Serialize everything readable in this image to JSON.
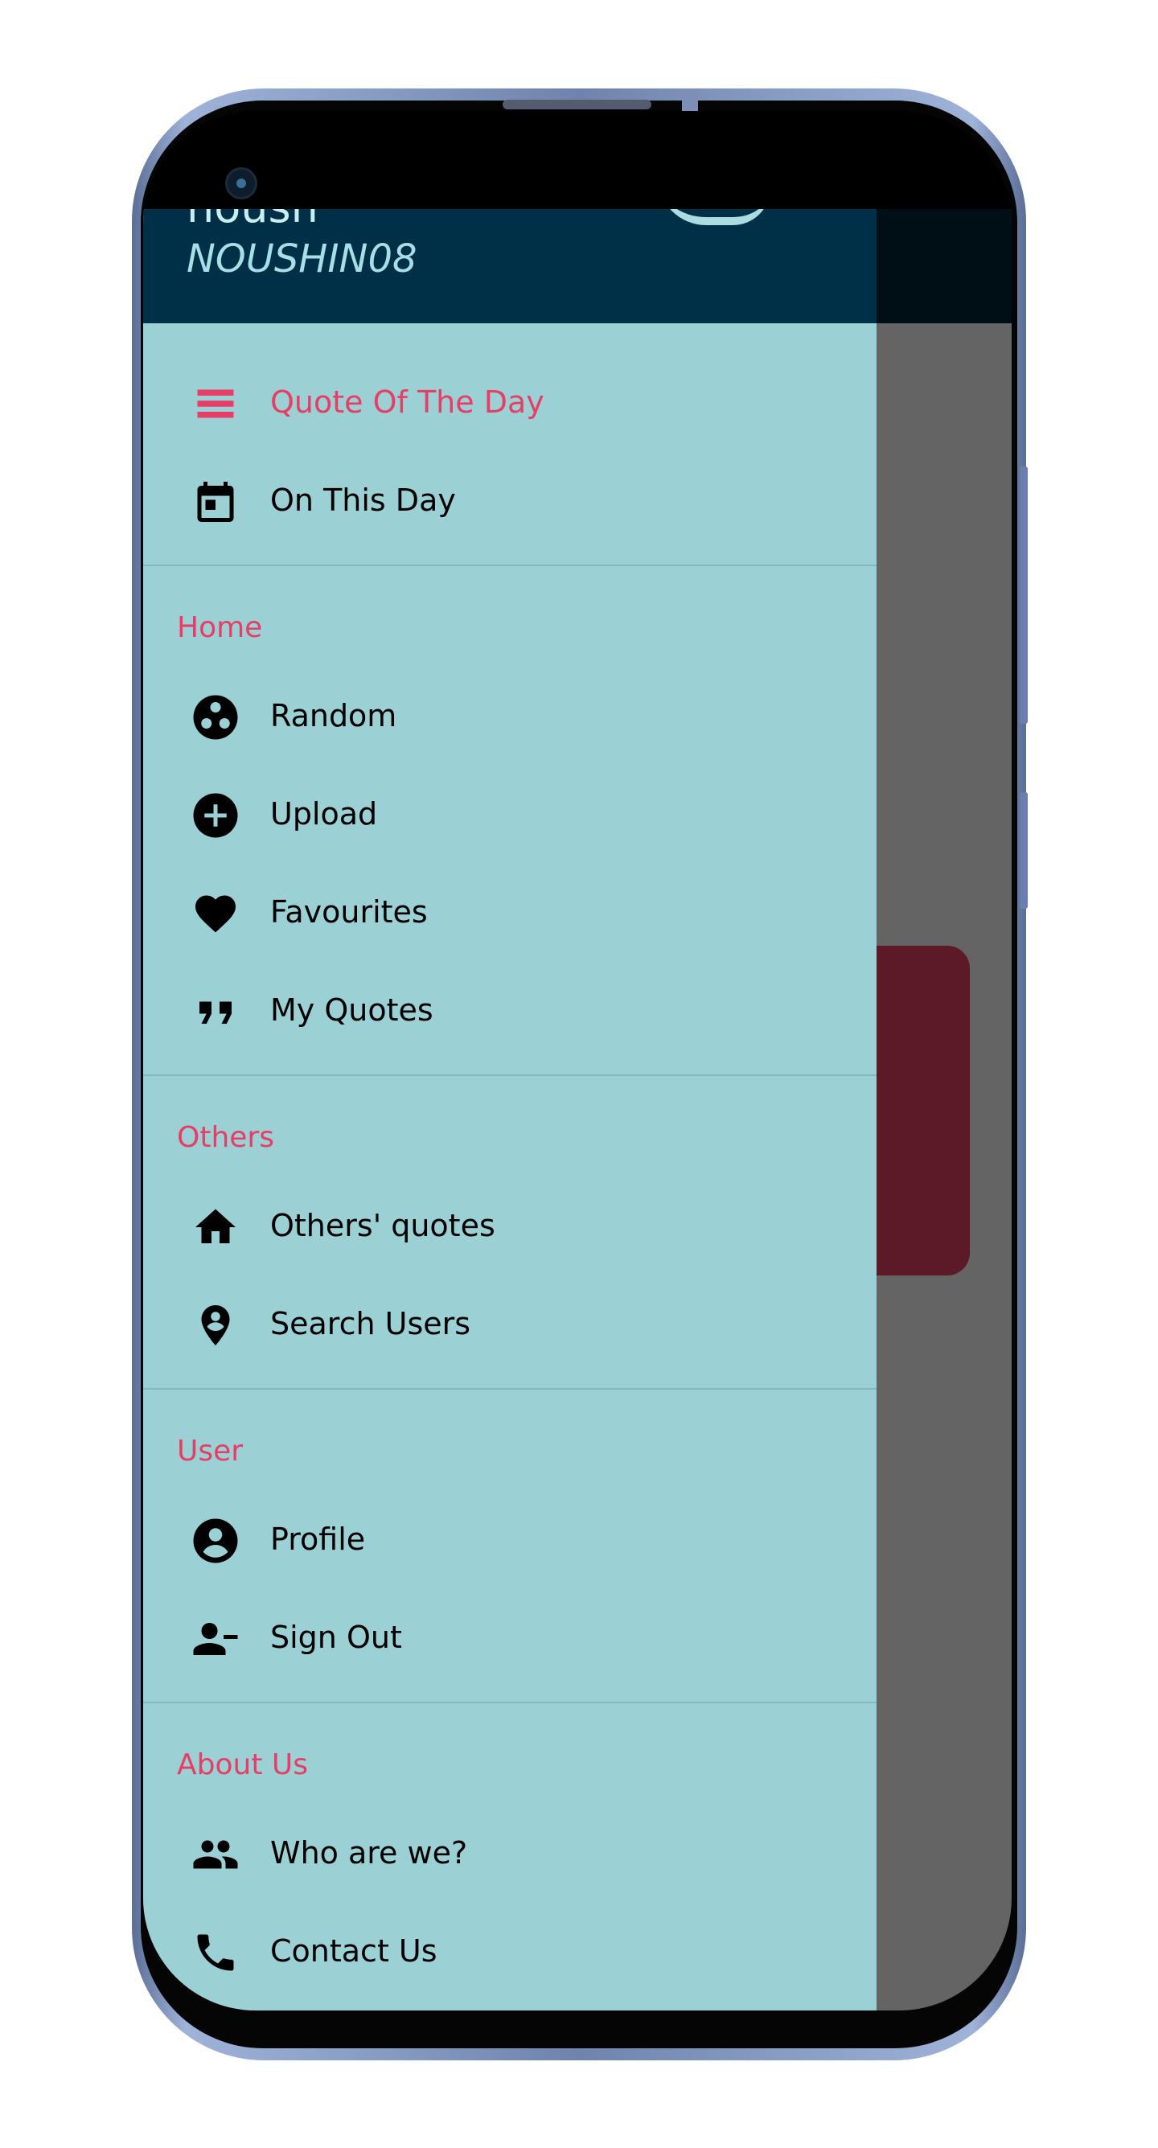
{
  "drawer": {
    "header": {
      "name": "noush",
      "username": "NOUSHIN08"
    },
    "top_items": [
      {
        "label": "Quote Of The Day",
        "icon": "list-icon",
        "active": true
      },
      {
        "label": "On This Day",
        "icon": "calendar-icon",
        "active": false
      }
    ],
    "sections": [
      {
        "title": "Home",
        "items": [
          {
            "label": "Random",
            "icon": "random-icon"
          },
          {
            "label": "Upload",
            "icon": "add-circle-icon"
          },
          {
            "label": "Favourites",
            "icon": "heart-icon"
          },
          {
            "label": "My Quotes",
            "icon": "quote-icon"
          }
        ]
      },
      {
        "title": "Others",
        "items": [
          {
            "label": "Others' quotes",
            "icon": "home-icon"
          },
          {
            "label": "Search Users",
            "icon": "person-pin-icon"
          }
        ]
      },
      {
        "title": "User",
        "items": [
          {
            "label": "Profile",
            "icon": "account-circle-icon"
          },
          {
            "label": "Sign Out",
            "icon": "person-remove-icon"
          }
        ]
      },
      {
        "title": "About Us",
        "items": [
          {
            "label": "Who are we?",
            "icon": "people-icon"
          },
          {
            "label": "Contact Us",
            "icon": "phone-icon"
          }
        ]
      }
    ]
  },
  "colors": {
    "drawer_background": "#9bd0d4",
    "header_background": "#003047",
    "accent": "#e83e65",
    "scrim": "#646464"
  }
}
